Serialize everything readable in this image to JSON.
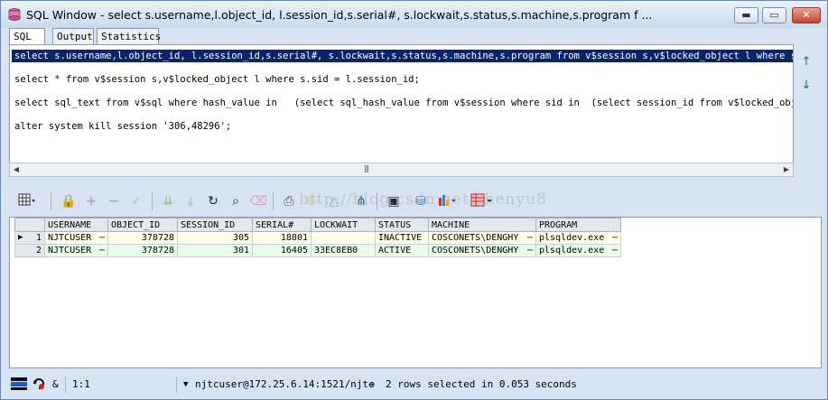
{
  "window": {
    "title": "SQL Window - select s.username,l.object_id, l.session_id,s.serial#, s.lockwait,s.status,s.machine,s.program f ...",
    "controls": {
      "minimize": "▬",
      "maximize": "▭",
      "close": "✕"
    }
  },
  "tabs": [
    {
      "label": "SQL",
      "active": true
    },
    {
      "label": "Output",
      "active": false
    },
    {
      "label": "Statistics",
      "active": false
    }
  ],
  "editor": {
    "lines": [
      "select s.username,l.object_id, l.session_id,s.serial#, s.lockwait,s.status,s.machine,s.program from v$session s,v$locked_object l where s.sid = ",
      "select * from v$session s,v$locked_object l where s.sid = l.session_id;",
      "select sql_text from v$sql where hash_value in   (select sql_hash_value from v$session where sid in  (select session_id from v$locked_object));",
      "alter system kill session '306,48296';"
    ]
  },
  "side_buttons": {
    "up": "↑",
    "down": "↓"
  },
  "toolbar": {
    "icons": [
      "grid-menu-icon",
      "lock-icon",
      "add-record-icon",
      "delete-record-icon",
      "post-record-icon",
      "next-page-icon",
      "last-page-icon",
      "refresh-icon",
      "find-icon",
      "clear-icon",
      "print-icon",
      "filter-icon",
      "sort-icon",
      "query-builder-icon",
      "save-icon",
      "export-icon",
      "chart-icon",
      "table-icon"
    ]
  },
  "results": {
    "columns": [
      "USERNAME",
      "OBJECT_ID",
      "SESSION_ID",
      "SERIAL#",
      "LOCKWAIT",
      "STATUS",
      "MACHINE",
      "PROGRAM"
    ],
    "rows": [
      [
        "NJTCUSER",
        "378728",
        "305",
        "18801",
        "",
        "INACTIVE",
        "COSCONETS\\DENGHY",
        "plsqldev.exe"
      ],
      [
        "NJTCUSER",
        "378728",
        "301",
        "16405",
        "33EC8EB0",
        "ACTIVE",
        "COSCONETS\\DENGHY",
        "plsqldev.exe"
      ]
    ],
    "row_numbers": [
      "1",
      "2"
    ],
    "current_row_marker": "▶"
  },
  "watermark": "http://blog.csdn.net/zhenyu8",
  "status": {
    "position": "1:1",
    "connection": "njtcuser@172.25.6.14:1521/njtc",
    "message": "2 rows selected in 0.053 seconds"
  }
}
